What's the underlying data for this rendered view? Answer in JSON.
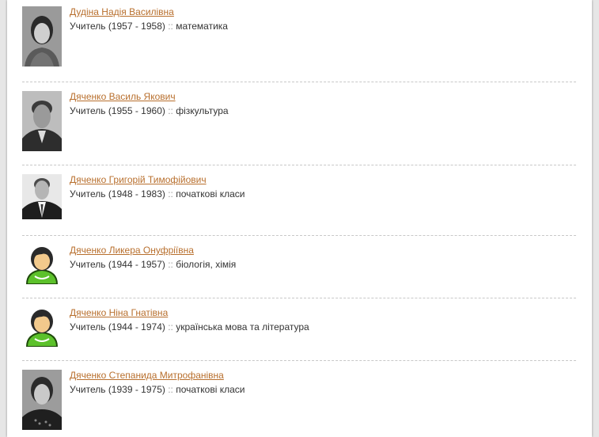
{
  "colors": {
    "link": "#b86f2d",
    "text": "#333333",
    "divider": "#c8c8c8",
    "avatar_green": "#5cc12b"
  },
  "separator": "::",
  "teachers": [
    {
      "name": "Дудіна Надія Василівна",
      "role": "Учитель",
      "years": "(1957 - 1958)",
      "subject": "математика",
      "photo": "portrait-photo"
    },
    {
      "name": "Дяченко Василь Якович",
      "role": "Учитель",
      "years": "(1955 - 1960)",
      "subject": "фізкультура",
      "photo": "portrait-photo"
    },
    {
      "name": "Дяченко Григорій Тимофійович",
      "role": "Учитель",
      "years": "(1948 - 1983)",
      "subject": "початкові класи",
      "photo": "portrait-photo"
    },
    {
      "name": "Дяченко Ликера Онуфріївна",
      "role": "Учитель",
      "years": "(1944 - 1957)",
      "subject": "біологія, хімія",
      "photo": "female-avatar-icon"
    },
    {
      "name": "Дяченко Ніна Гнатівна",
      "role": "Учитель",
      "years": "(1944 - 1974)",
      "subject": "українська мова та література",
      "photo": "female-avatar-icon"
    },
    {
      "name": "Дяченко Степанида Митрофанівна",
      "role": "Учитель",
      "years": "(1939 - 1975)",
      "subject": "початкові класи",
      "photo": "portrait-photo"
    }
  ]
}
